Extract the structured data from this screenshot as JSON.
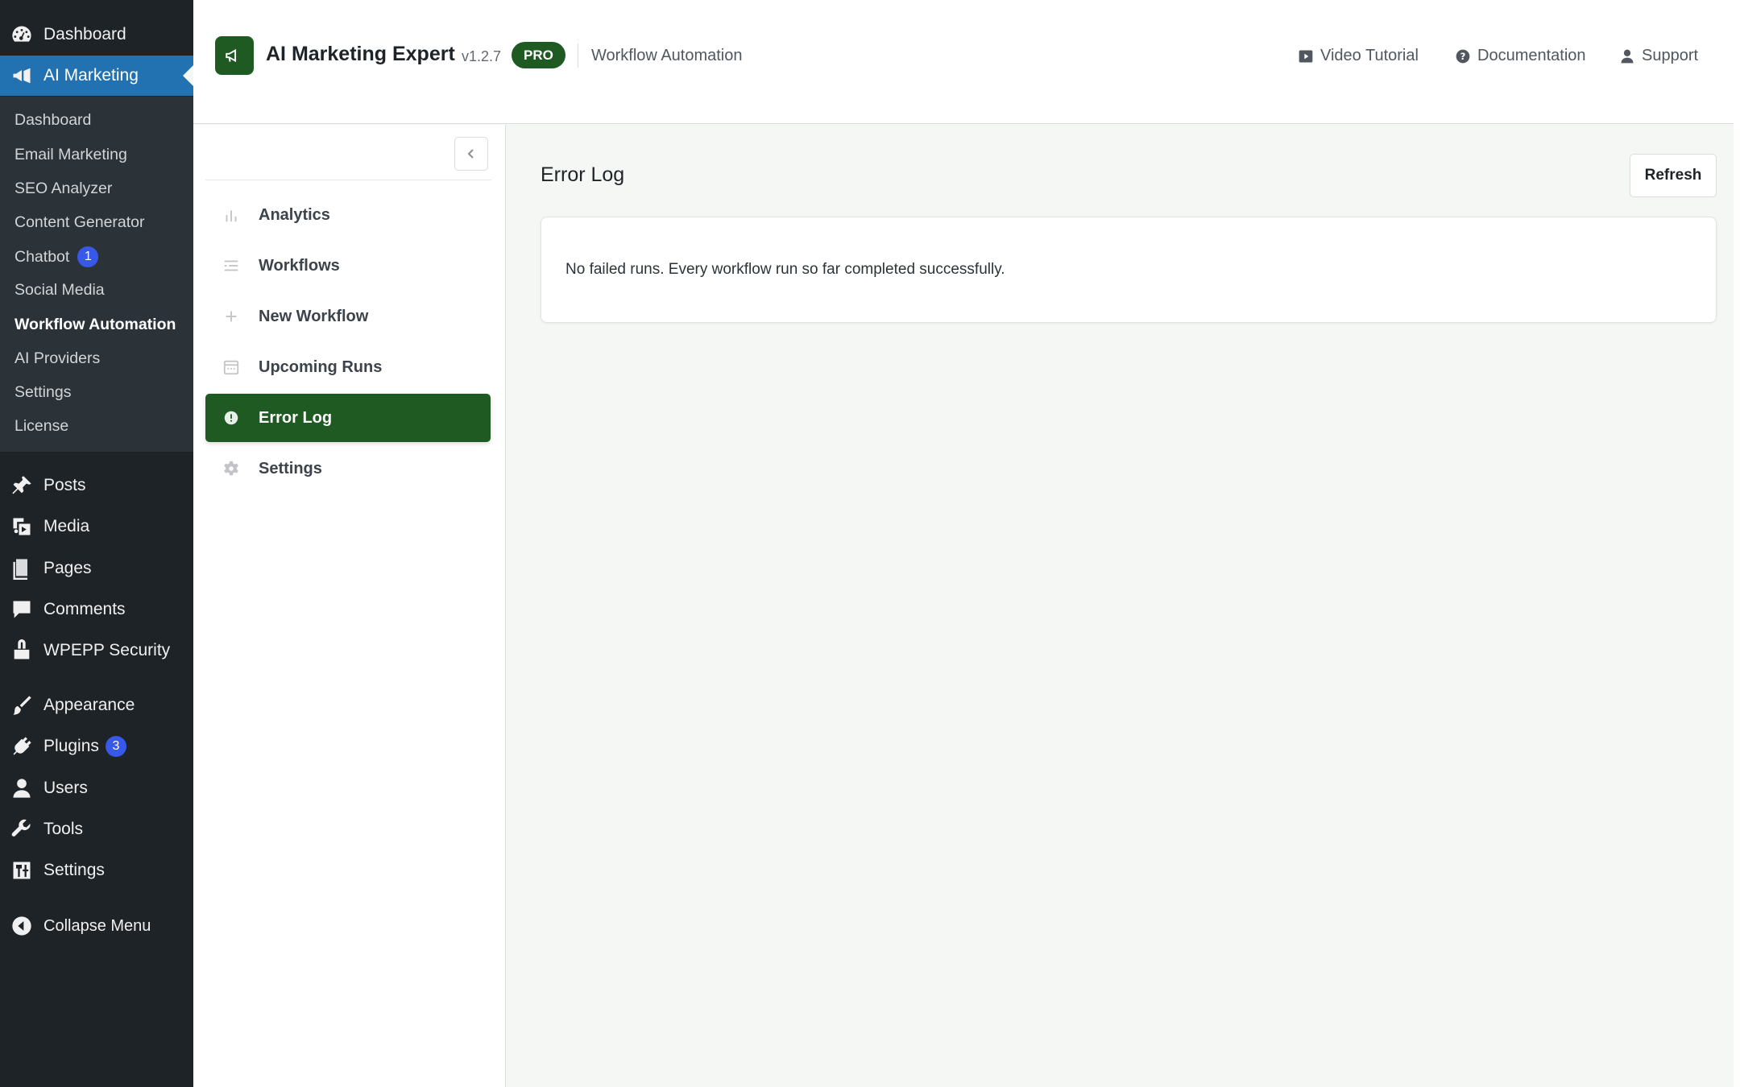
{
  "wp_menu": {
    "top_items": [
      {
        "label": "Dashboard",
        "icon": "dashboard-icon"
      },
      {
        "label": "AI Marketing",
        "icon": "megaphone-icon"
      }
    ],
    "submenu": [
      {
        "label": "Dashboard"
      },
      {
        "label": "Email Marketing"
      },
      {
        "label": "SEO Analyzer"
      },
      {
        "label": "Content Generator"
      },
      {
        "label": "Chatbot",
        "badge": "1"
      },
      {
        "label": "Social Media"
      },
      {
        "label": "Workflow Automation"
      },
      {
        "label": "AI Providers"
      },
      {
        "label": "Settings"
      },
      {
        "label": "License"
      }
    ],
    "items": [
      {
        "label": "Posts",
        "icon": "pin-icon"
      },
      {
        "label": "Media",
        "icon": "media-icon"
      },
      {
        "label": "Pages",
        "icon": "pages-icon"
      },
      {
        "label": "Comments",
        "icon": "comment-icon"
      },
      {
        "label": "WPEPP Security",
        "icon": "lock-icon"
      },
      {
        "label": "Appearance",
        "icon": "brush-icon"
      },
      {
        "label": "Plugins",
        "icon": "plug-icon",
        "badge": "3"
      },
      {
        "label": "Users",
        "icon": "user-icon"
      },
      {
        "label": "Tools",
        "icon": "wrench-icon"
      },
      {
        "label": "Settings",
        "icon": "settings-sliders-icon"
      },
      {
        "label": "Collapse Menu",
        "icon": "collapse-arrow-icon"
      }
    ]
  },
  "header": {
    "title": "AI Marketing Expert",
    "version": "v1.2.7",
    "pro_label": "PRO",
    "section": "Workflow Automation",
    "links": [
      {
        "label": "Video Tutorial",
        "icon": "video-icon"
      },
      {
        "label": "Documentation",
        "icon": "help-icon"
      },
      {
        "label": "Support",
        "icon": "user-icon"
      }
    ]
  },
  "plugin_nav": {
    "items": [
      {
        "label": "Analytics",
        "icon": "bar-chart-icon"
      },
      {
        "label": "Workflows",
        "icon": "list-icon"
      },
      {
        "label": "New Workflow",
        "icon": "plus-icon"
      },
      {
        "label": "Upcoming Runs",
        "icon": "calendar-icon"
      },
      {
        "label": "Error Log",
        "icon": "alert-icon"
      },
      {
        "label": "Settings",
        "icon": "gear-icon"
      }
    ],
    "active": "Error Log"
  },
  "main": {
    "title": "Error Log",
    "refresh_label": "Refresh",
    "empty_message": "No failed runs. Every workflow run so far completed successfully."
  },
  "colors": {
    "brand_green": "#1e5a22",
    "wp_blue": "#2271b1",
    "badge_blue": "#3858e9",
    "admin_bg": "#1d2327"
  }
}
